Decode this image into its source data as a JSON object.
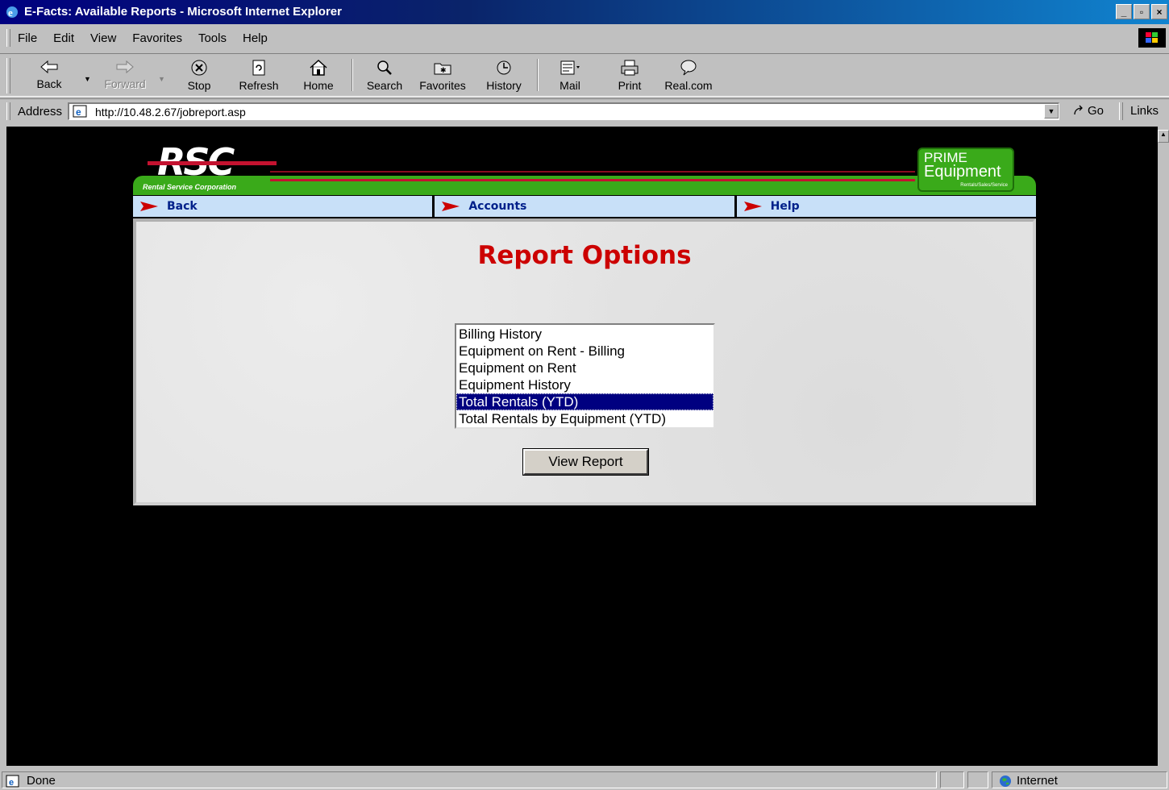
{
  "window": {
    "title": "E-Facts: Available Reports - Microsoft Internet Explorer",
    "controls": [
      "minimize-icon",
      "maximize-icon",
      "close-icon"
    ]
  },
  "menu": {
    "items": [
      {
        "label": "File"
      },
      {
        "label": "Edit"
      },
      {
        "label": "View"
      },
      {
        "label": "Favorites"
      },
      {
        "label": "Tools"
      },
      {
        "label": "Help"
      }
    ]
  },
  "toolbar": {
    "back": "Back",
    "forward": "Forward",
    "stop": "Stop",
    "refresh": "Refresh",
    "home": "Home",
    "search": "Search",
    "favorites": "Favorites",
    "history": "History",
    "mail": "Mail",
    "print": "Print",
    "realcom": "Real.com"
  },
  "address": {
    "label": "Address",
    "url": "http://10.48.2.67/jobreport.asp",
    "go": "Go",
    "links": "Links"
  },
  "page": {
    "logo": "RSC",
    "logo_subtitle": "Rental Service Corporation",
    "prime_line1": "PRIME",
    "prime_line2": "Equipment",
    "prime_line3": "Rentals/Sales/Service",
    "nav": [
      "Back",
      "Accounts",
      "Help"
    ],
    "heading": "Report Options",
    "report_options": [
      "Billing History",
      "Equipment on Rent - Billing",
      "Equipment on Rent",
      "Equipment History",
      "Total Rentals (YTD)",
      "Total Rentals by Equipment (YTD)"
    ],
    "selected_option": "Total Rentals (YTD)",
    "view_button": "View Report"
  },
  "status": {
    "text": "Done",
    "zone": "Internet"
  },
  "colors": {
    "titlebar": "#000080",
    "heading": "#cc0000",
    "selection": "#000080",
    "banner_green": "#3aaa1a",
    "nav_bg": "#c8e0f8"
  }
}
